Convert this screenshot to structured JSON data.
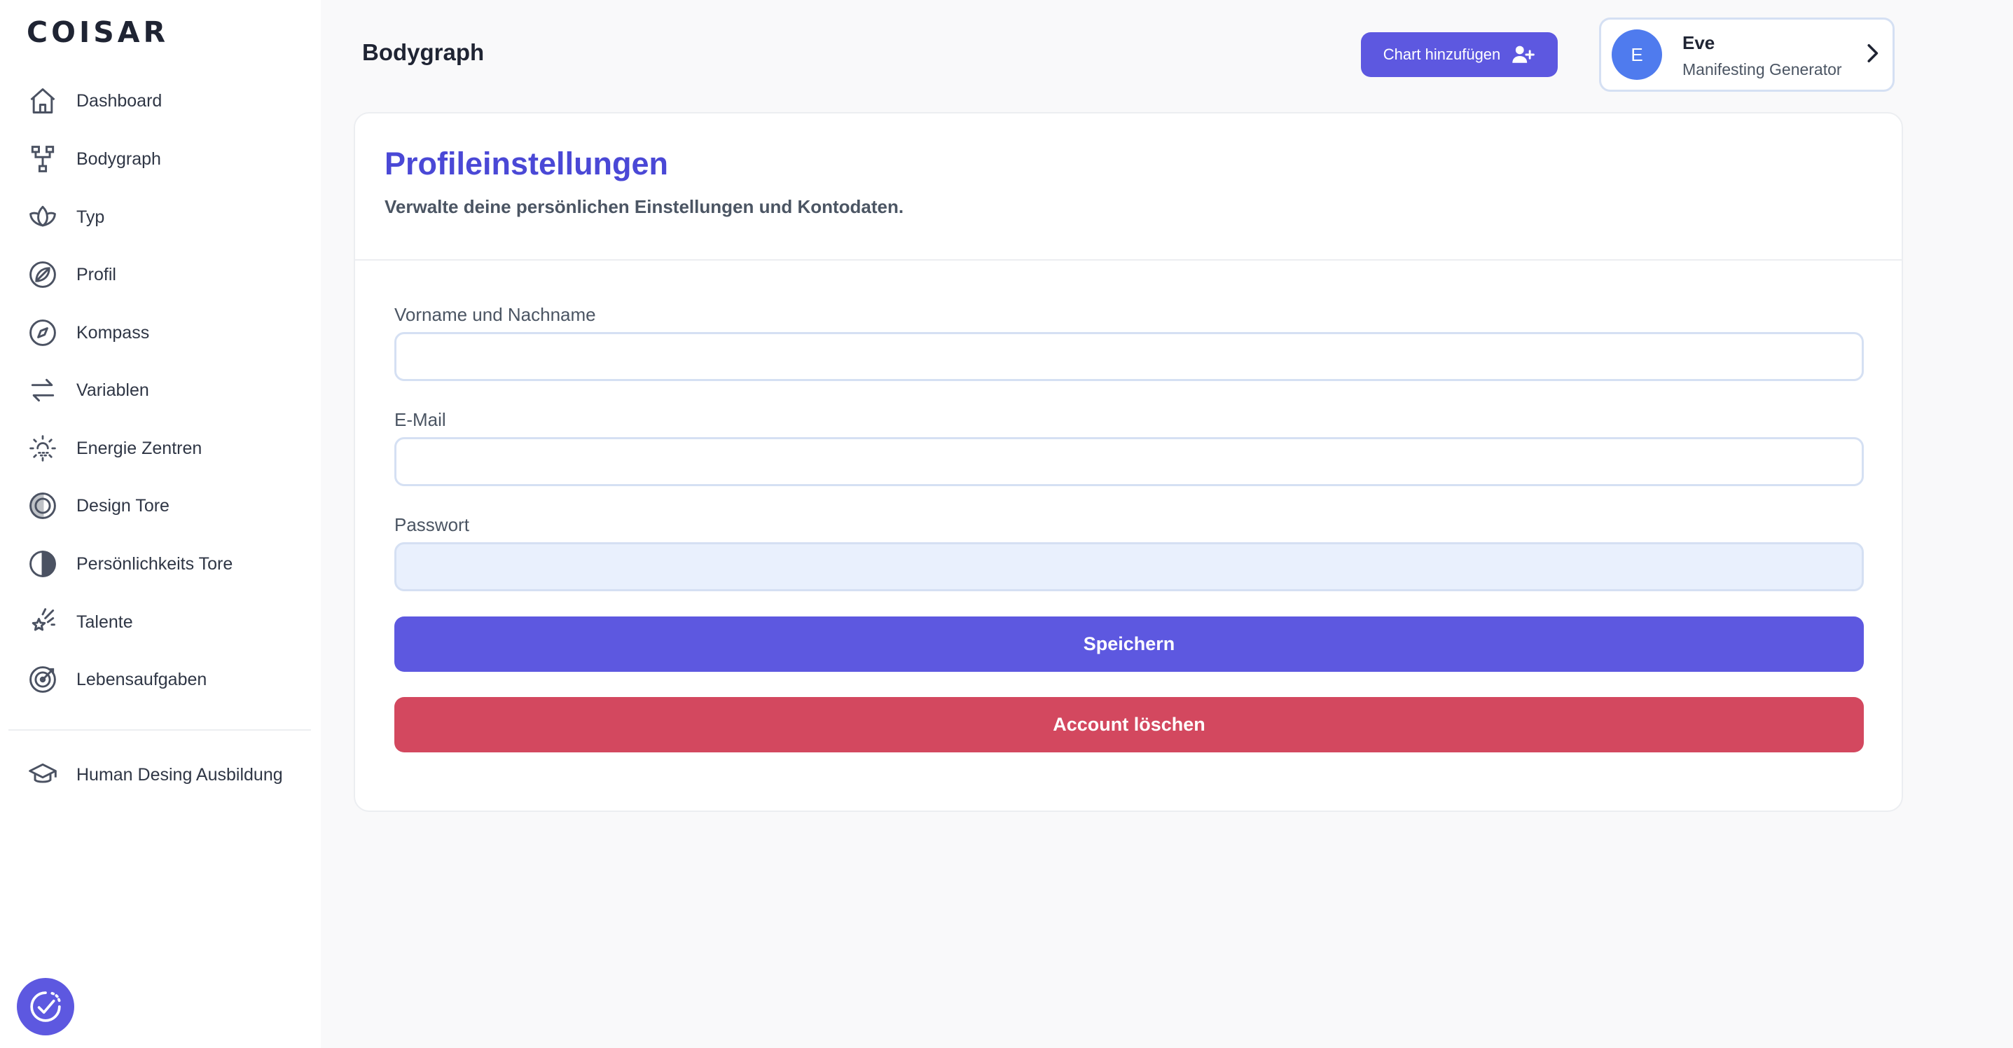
{
  "app": {
    "logo": "COISAR"
  },
  "sidebar": {
    "items": [
      {
        "label": "Dashboard",
        "icon": "home-icon"
      },
      {
        "label": "Bodygraph",
        "icon": "bodygraph-icon"
      },
      {
        "label": "Typ",
        "icon": "lotus-icon"
      },
      {
        "label": "Profil",
        "icon": "leaf-circle-icon"
      },
      {
        "label": "Kompass",
        "icon": "compass-icon"
      },
      {
        "label": "Variablen",
        "icon": "arrows-swap-icon"
      },
      {
        "label": "Energie Zentren",
        "icon": "energy-centers-icon"
      },
      {
        "label": "Design Tore",
        "icon": "half-circle-icon"
      },
      {
        "label": "Persönlichkeits Tore",
        "icon": "half-circle-right-icon"
      },
      {
        "label": "Talente",
        "icon": "sparkle-star-icon"
      },
      {
        "label": "Lebensaufgaben",
        "icon": "target-icon"
      }
    ],
    "secondary": [
      {
        "label": "Human Desing Ausbildung",
        "icon": "graduation-cap-icon"
      }
    ],
    "help_icon": "clock-check-icon"
  },
  "header": {
    "title": "Bodygraph",
    "add_chart_label": "Chart hinzufügen",
    "profile": {
      "initial": "E",
      "name": "Eve",
      "type": "Manifesting Generator"
    }
  },
  "settings": {
    "title": "Profileinstellungen",
    "subtitle": "Verwalte deine persönlichen Einstellungen und Kontodaten.",
    "fields": {
      "name_label": "Vorname und Nachname",
      "name_value": "",
      "email_label": "E-Mail",
      "email_value": "",
      "password_label": "Passwort",
      "password_value": ""
    },
    "save_label": "Speichern",
    "delete_label": "Account löschen"
  },
  "colors": {
    "accent": "#5d58e0",
    "title": "#4a48d6",
    "danger": "#d3485f",
    "avatar": "#4f7bee"
  }
}
